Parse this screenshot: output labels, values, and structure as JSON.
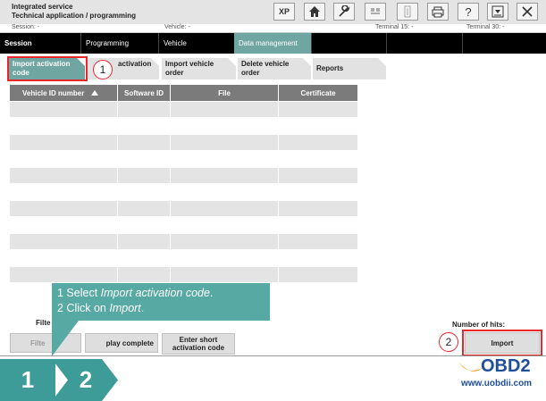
{
  "titlebar": {
    "line1": "Integrated service",
    "line2": "Technical application / programming",
    "buttons": {
      "xp": "XP"
    }
  },
  "status": {
    "session": "Session:  -",
    "vehicle": "Vehicle:  -",
    "terminal15": "Terminal 15:  -",
    "terminal30": "Terminal 30:  -"
  },
  "nav": {
    "session": "Session",
    "programming": "Programming",
    "vehicle": "Vehicle",
    "data_management": "Data management"
  },
  "subtabs": {
    "import_activation": "Import activation code",
    "activation_fragment": "activation",
    "import_vehicle_order": "Import vehicle order",
    "delete_vehicle_order": "Delete vehicle order",
    "reports": "Reports"
  },
  "table": {
    "columns": [
      "Vehicle ID number",
      "Software ID",
      "File",
      "Certificate"
    ],
    "rows": [
      [
        "",
        "",
        "",
        ""
      ],
      [
        "",
        "",
        "",
        ""
      ],
      [
        "",
        "",
        "",
        ""
      ],
      [
        "",
        "",
        "",
        ""
      ],
      [
        "",
        "",
        "",
        ""
      ],
      [
        "",
        "",
        "",
        ""
      ]
    ]
  },
  "controls": {
    "filter_label": "Filte",
    "filter_button": "Filte",
    "display_complete": "play complete",
    "enter_short": "Enter short activation code",
    "hits_label": "Number of hits:",
    "import": "Import"
  },
  "annotations": {
    "marker1": "1",
    "marker2": "2",
    "instruction_line1_prefix": "1 Select ",
    "instruction_line1_em": "Import activation code",
    "instruction_line1_suffix": ".",
    "instruction_line2_prefix": "2 Click on ",
    "instruction_line2_em": "Import",
    "instruction_line2_suffix": "."
  },
  "footer": {
    "step1": "1",
    "step2": "2",
    "logo_text": "OBD2",
    "site": "www.uobdii.com"
  },
  "colors": {
    "teal": "#6fa6a2",
    "step_teal": "#3d9c98",
    "annotation_red": "#e8262c",
    "logo_orange": "#f5a31a",
    "logo_blue": "#1f4e9c"
  }
}
